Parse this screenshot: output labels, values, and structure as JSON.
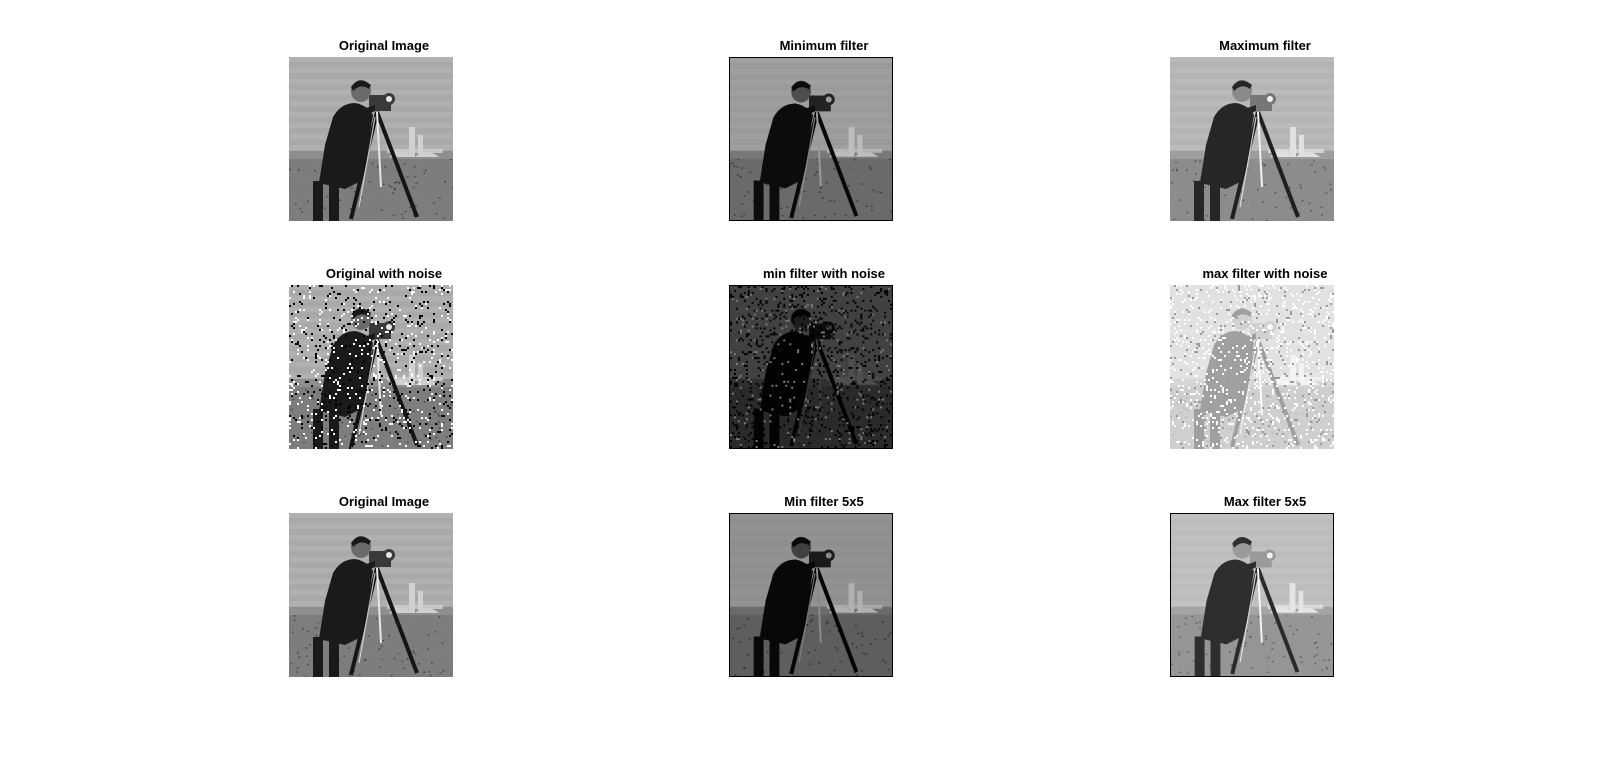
{
  "figure": {
    "background": "#ffffff",
    "panels": [
      {
        "title": "Original Image",
        "variant": "original"
      },
      {
        "title": "Minimum filter",
        "variant": "min"
      },
      {
        "title": "Maximum filter",
        "variant": "max"
      },
      {
        "title": "Original with noise",
        "variant": "noise"
      },
      {
        "title": "min filter with noise",
        "variant": "min-noise"
      },
      {
        "title": "max filter with noise",
        "variant": "max-noise"
      },
      {
        "title": "Original Image",
        "variant": "original"
      },
      {
        "title": "Min filter 5x5",
        "variant": "min5"
      },
      {
        "title": "Max filter 5x5",
        "variant": "max5"
      }
    ]
  }
}
